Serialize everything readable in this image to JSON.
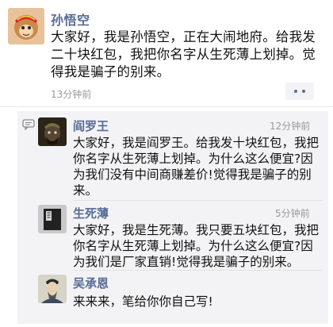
{
  "post": {
    "author": "孙悟空",
    "text": "大家好，我是孙悟空，正在大闹地府。给我发二十块红包，我把你名字从生死薄上划掉。觉得我是骗子的别来。",
    "time": "13分钟前",
    "author_color": "#576b95"
  },
  "comments": [
    {
      "author": "阎罗王",
      "time": "12分钟前",
      "text": "大家好，我是阎罗王。给我发十块红包，我把你名字从生死薄上划掉。为什么这么便宜?因为我们没有中间商赚差价!觉得我是骗子的别来。",
      "avatar": "king-of-hell-avatar"
    },
    {
      "author": "生死薄",
      "time": "5分钟前",
      "text": "大家好，我是生死薄。我只要五块红包，我把你名字从生死薄上划掉。为什么这么便宜?因为我们是厂家直销!觉得我是骗子的别来。",
      "avatar": "book-avatar"
    },
    {
      "author": "吴承恩",
      "time": "",
      "text": "来来来，笔给你你自己写!",
      "avatar": "author-avatar"
    }
  ]
}
